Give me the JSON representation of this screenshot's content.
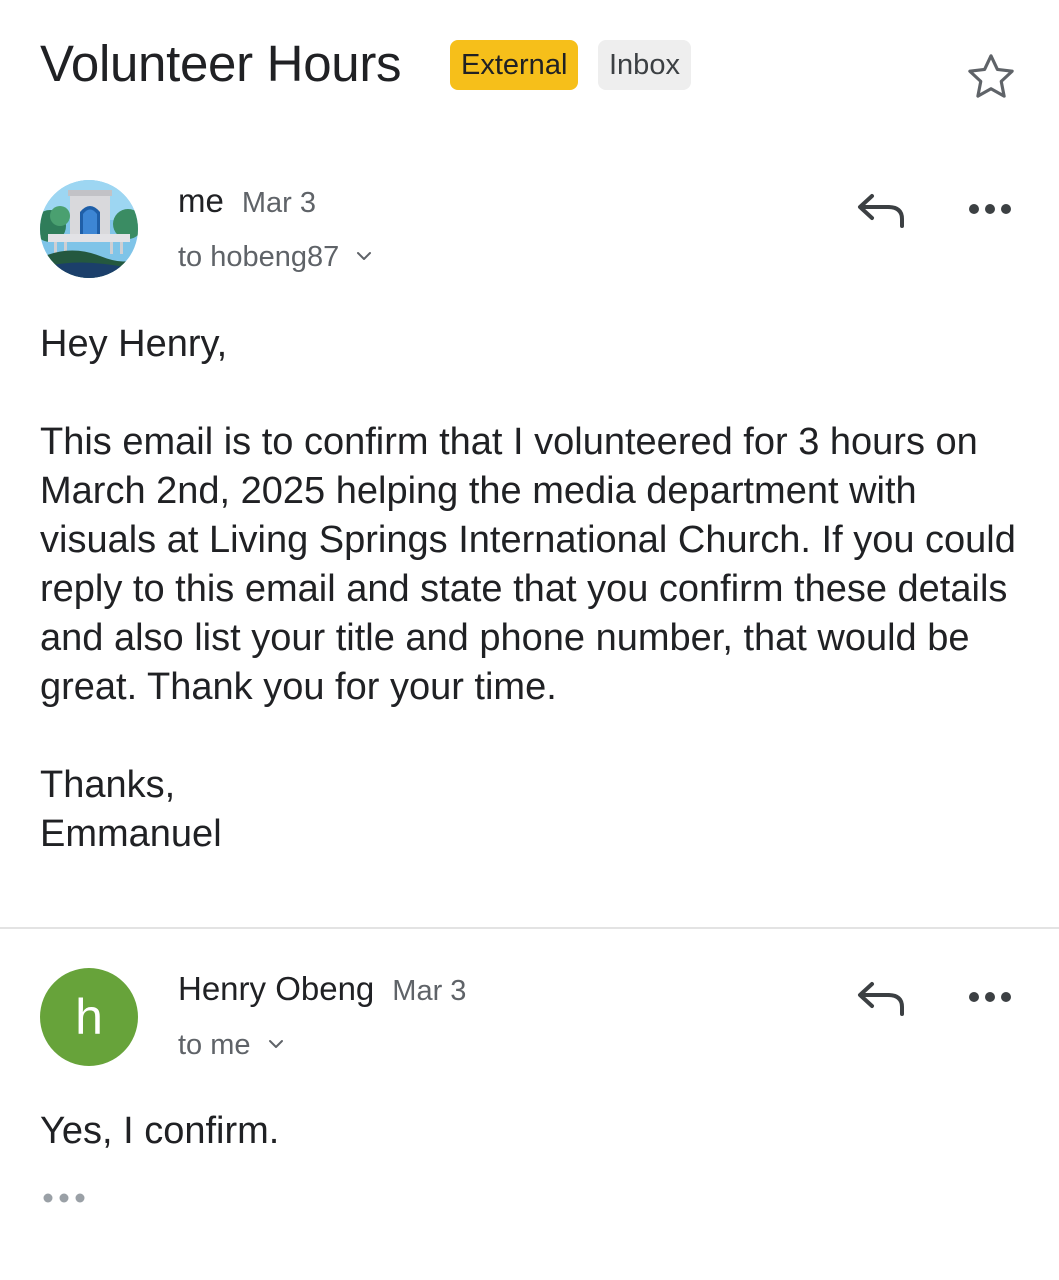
{
  "thread": {
    "subject": "Volunteer Hours",
    "labels": {
      "external": "External",
      "inbox": "Inbox"
    },
    "label_colors": {
      "external": "#f6bf1a",
      "inbox": "#eeeeee"
    }
  },
  "messages": [
    {
      "sender": "me",
      "date": "Mar 3",
      "recipient": "to hobeng87",
      "avatar": "profile-photo",
      "body": {
        "greeting": "Hey Henry,",
        "paragraph": "This email is to confirm that I volunteered for 3 hours on March 2nd, 2025 helping the media department with visuals at Living Springs International Church. If you could reply to this email and state that you confirm these details and also list your title and phone number, that would be great. Thank you for your time.",
        "closing": "Thanks,",
        "signature": "Emmanuel"
      }
    },
    {
      "sender": "Henry Obeng",
      "date": "Mar 3",
      "recipient": "to me",
      "avatar_letter": "h",
      "avatar_color": "#67a33a",
      "body": {
        "text": "Yes, I confirm."
      }
    }
  ],
  "icons": {
    "star": "star-outline-icon",
    "reply": "reply-arrow-icon",
    "more": "more-horizontal-icon",
    "expand": "chevron-down-icon",
    "trimmed": "show-trimmed-content-icon"
  }
}
